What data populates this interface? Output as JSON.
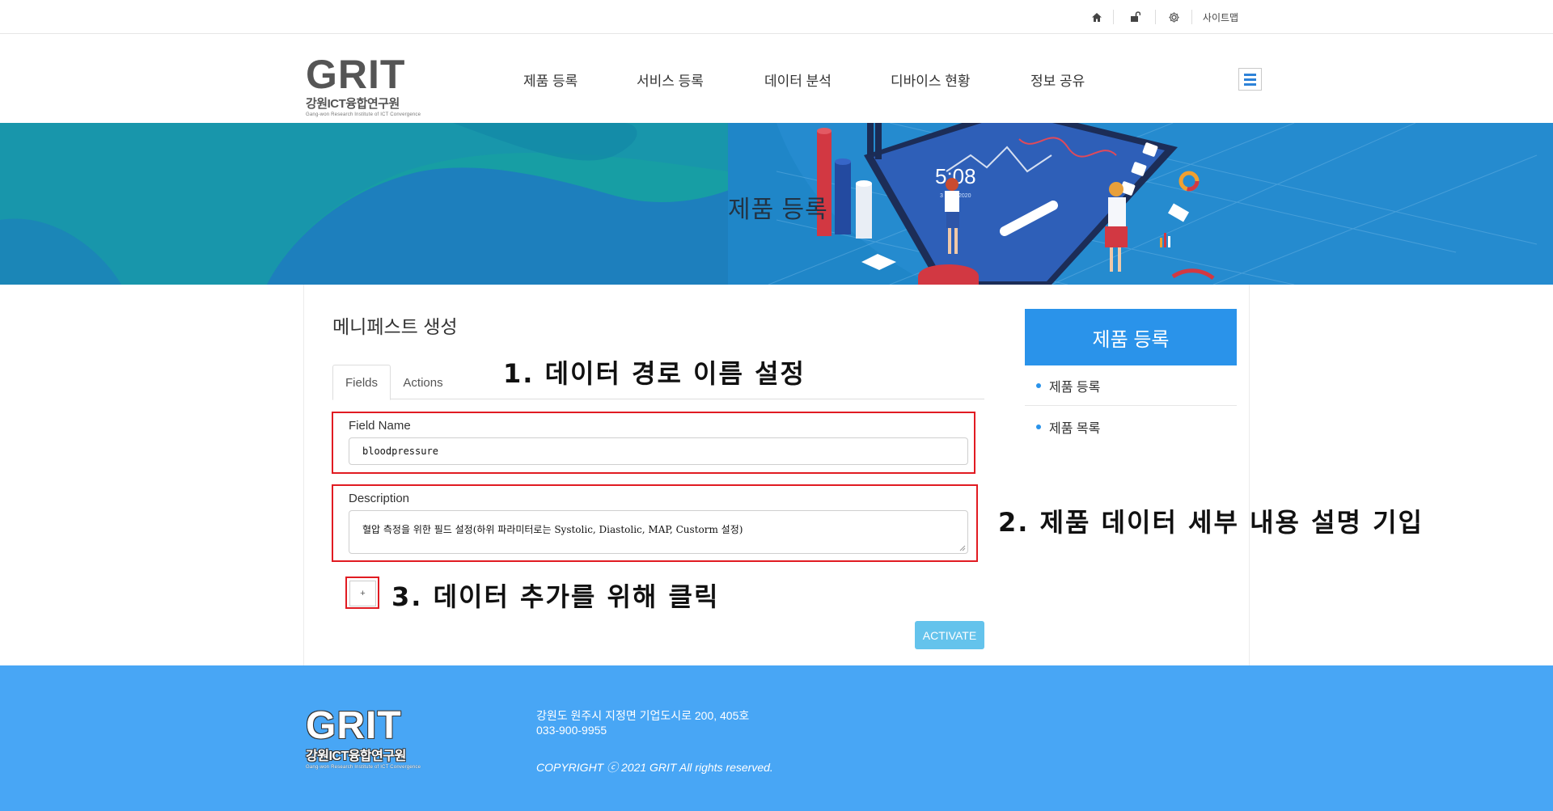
{
  "topbar": {
    "icons": [
      "home-icon",
      "lock-icon",
      "gear-icon"
    ],
    "sitemap": "사이트맵"
  },
  "header": {
    "logo": {
      "grit": "GRIT",
      "korean": "강원ICT융합연구원",
      "english": "Gang-won Research Institute of ICT Convergence"
    },
    "nav": [
      "제품 등록",
      "서비스 등록",
      "데이터 분석",
      "디바이스 현황",
      "정보 공유"
    ]
  },
  "banner": {
    "title": "제품 등록",
    "clock_time": "5:08",
    "clock_date": "3 June 2020"
  },
  "main": {
    "heading": "메니페스트 생성",
    "tabs": [
      "Fields",
      "Actions"
    ],
    "annotations": {
      "step1": "1. 데이터 경로 이름 설정",
      "step2": "2. 제품 데이터 세부 내용 설명 기입",
      "step3": "3. 데이터 추가를 위해 클릭"
    },
    "field_name_label": "Field Name",
    "field_name_value": "bloodpressure",
    "description_label": "Description",
    "description_value": "혈압 측정을 위한 필드 설정(하위 파라미터로는 Systolic, Diastolic, MAP, Custorm 설정)",
    "add_button": "+",
    "activate_button": "ACTIVATE"
  },
  "sidebar": {
    "title": "제품 등록",
    "items": [
      "제품 등록",
      "제품 목록"
    ]
  },
  "footer": {
    "address": "강원도 원주시 지정면 기업도시로 200, 405호",
    "phone": "033-900-9955",
    "copyright": "COPYRIGHT ⓒ 2021 GRIT All rights reserved."
  },
  "colors": {
    "accent": "#2a93ea",
    "footer_bg": "#48a6f5",
    "banner_teal": "#189ea3",
    "highlight_red": "#e11b22",
    "activate_btn": "#64c3ec"
  }
}
